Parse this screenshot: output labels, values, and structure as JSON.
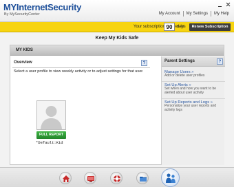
{
  "app": {
    "brand_prefix": "MY",
    "brand_name": "InternetSecurity",
    "tagline": "By MySecurityCenter"
  },
  "menu": {
    "account": "My Account",
    "settings": "My Settings",
    "help": "My Help"
  },
  "subscription": {
    "text": "Your subscription expires in",
    "days": "90",
    "days_label": "days",
    "renew_label": "Renew Subscription"
  },
  "page": {
    "title": "Keep My Kids Safe"
  },
  "panel": {
    "title": "MY KIDS"
  },
  "overview": {
    "title": "Overview",
    "description": "Select a user profile to view weekly activity or to adjust settings for that user.",
    "help_label": "?",
    "profile": {
      "button_label": "FULL REPORT",
      "name": "*Default:Kid"
    }
  },
  "parent_settings": {
    "title": "Parent Settings",
    "help_label": "?",
    "items": [
      {
        "link": "Manage Users »",
        "desc": "Add or delete user profiles"
      },
      {
        "link": "Set Up Alerts »",
        "desc": "Set when and how you want to be alerted about user activity"
      },
      {
        "link": "Set Up Reports and Logs »",
        "desc": "Personalize your user reports and activity logs"
      }
    ]
  },
  "colors": {
    "brand_blue": "#1d4f9a",
    "subscription_bar": "#f7d410",
    "renew_button": "#3d3d3d",
    "full_report_button": "#2e9d36",
    "link_blue": "#2a57a0"
  },
  "dock": [
    {
      "icon": "home-icon"
    },
    {
      "icon": "monitor-icon"
    },
    {
      "icon": "lifebuoy-icon"
    },
    {
      "icon": "folders-icon"
    },
    {
      "icon": "kids-icon"
    }
  ]
}
